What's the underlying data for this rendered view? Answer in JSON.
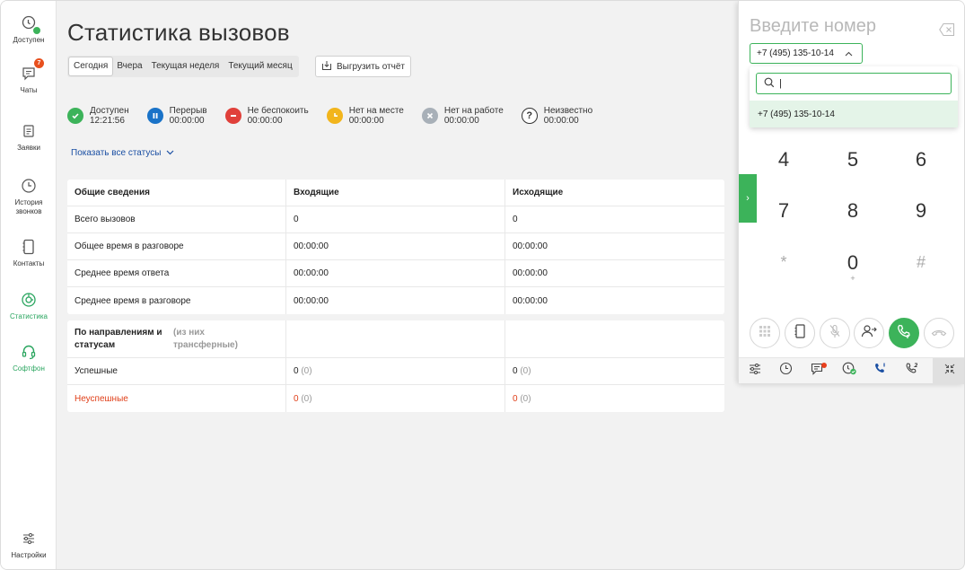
{
  "sidebar": {
    "items": [
      {
        "label": "Доступен",
        "icon": "status-icon"
      },
      {
        "label": "Чаты",
        "icon": "chat-icon",
        "badge": "7"
      },
      {
        "label": "Заявки",
        "icon": "requests-icon"
      },
      {
        "label": "История звонков",
        "icon": "history-icon"
      },
      {
        "label": "Контакты",
        "icon": "contacts-icon"
      },
      {
        "label": "Статистика",
        "icon": "statistics-icon"
      },
      {
        "label": "Софтфон",
        "icon": "softphone-icon"
      },
      {
        "label": "Настройки",
        "icon": "settings-icon"
      }
    ]
  },
  "main": {
    "title": "Статистика вызовов",
    "period_tabs": [
      "Сегодня",
      "Вчера",
      "Текущая неделя",
      "Текущий месяц"
    ],
    "active_tab": "Сегодня",
    "export_label": "Выгрузить отчёт",
    "statuses": [
      {
        "name": "Доступен",
        "time": "12:21:56",
        "color": "#3cb35a"
      },
      {
        "name": "Перерыв",
        "time": "00:00:00",
        "color": "#1a73c8"
      },
      {
        "name": "Не беспокоить",
        "time": "00:00:00",
        "color": "#e0403a"
      },
      {
        "name": "Нет на месте",
        "time": "00:00:00",
        "color": "#f2b51c"
      },
      {
        "name": "Нет на работе",
        "time": "00:00:00",
        "color": "#a8b0b8"
      },
      {
        "name": "Неизвестно",
        "time": "00:00:00",
        "color": "#333333"
      }
    ],
    "show_all_label": "Показать все статусы",
    "summary_table": {
      "headers": [
        "Общие сведения",
        "Входящие",
        "Исходящие"
      ],
      "rows": [
        [
          "Всего вызовов",
          "0",
          "0"
        ],
        [
          "Общее время в разговоре",
          "00:00:00",
          "00:00:00"
        ],
        [
          "Среднее время ответа",
          "00:00:00",
          "00:00:00"
        ],
        [
          "Среднее время в разговоре",
          "00:00:00",
          "00:00:00"
        ]
      ]
    },
    "direction_table": {
      "header_main": "По направлениям и статусам",
      "header_note": "(из них трансферные)",
      "rows": [
        {
          "label": "Успешные",
          "in": "0",
          "in_t": "(0)",
          "out": "0",
          "out_t": "(0)"
        },
        {
          "label": "Неуспешные",
          "in": "0",
          "in_t": "(0)",
          "out": "0",
          "out_t": "(0)"
        }
      ]
    }
  },
  "dialer": {
    "placeholder": "Введите номер",
    "caller_id": "+7 (495) 135-10-14",
    "search_value": "|",
    "dropdown_option": "+7 (495) 135-10-14",
    "keys": [
      "4",
      "5",
      "6",
      "7",
      "8",
      "9",
      "*",
      "0",
      "#"
    ],
    "zero_sub": "+"
  },
  "colors": {
    "accent": "#3cb35a",
    "link": "#1a4fa3",
    "danger": "#e0401a"
  }
}
